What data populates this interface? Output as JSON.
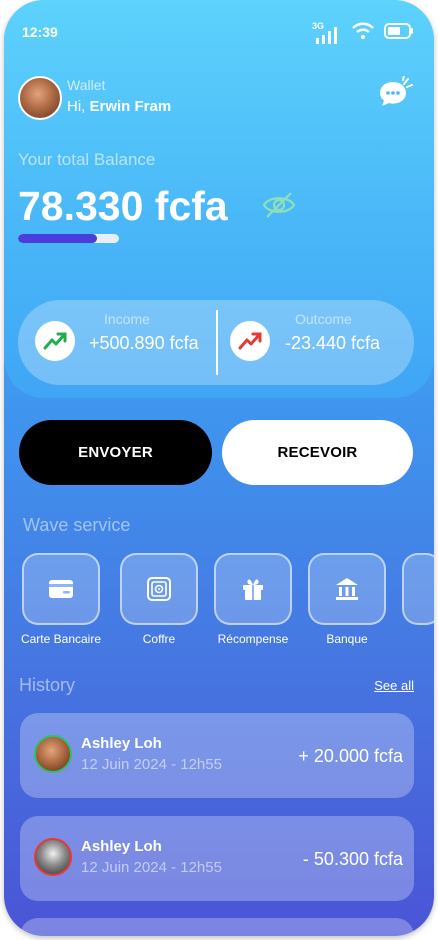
{
  "status_bar": {
    "time": "12:39",
    "network": "3G"
  },
  "header": {
    "subtitle": "Wallet",
    "greeting_prefix": "Hi, ",
    "user_name": "Erwin Fram"
  },
  "balance": {
    "label": "Your total Balance",
    "amount": "78.330 fcfa",
    "progress_fraction": 0.78
  },
  "income": {
    "title": "Income",
    "value": "+500.890 fcfa"
  },
  "outcome": {
    "title": "Outcome",
    "value": "-23.440 fcfa"
  },
  "actions": {
    "send": "ENVOYER",
    "receive": "RECEVOIR"
  },
  "services": {
    "title": "Wave service",
    "items": [
      {
        "label": "Carte Bancaire",
        "icon": "card-icon"
      },
      {
        "label": "Coffre",
        "icon": "safe-icon"
      },
      {
        "label": "Récompense",
        "icon": "gift-icon"
      },
      {
        "label": "Banque",
        "icon": "bank-icon"
      }
    ]
  },
  "history": {
    "title": "History",
    "see_all": "See all",
    "items": [
      {
        "name": "Ashley Loh",
        "date": "12 Juin 2024 - 12h55",
        "amount": "+ 20.000 fcfa"
      },
      {
        "name": "Ashley Loh",
        "date": "12 Juin 2024 - 12h55",
        "amount": "- 50.300 fcfa"
      }
    ]
  },
  "colors": {
    "accent": "#4a3ddb",
    "income_arrow": "#1fae4b",
    "outcome_arrow": "#e53935"
  }
}
